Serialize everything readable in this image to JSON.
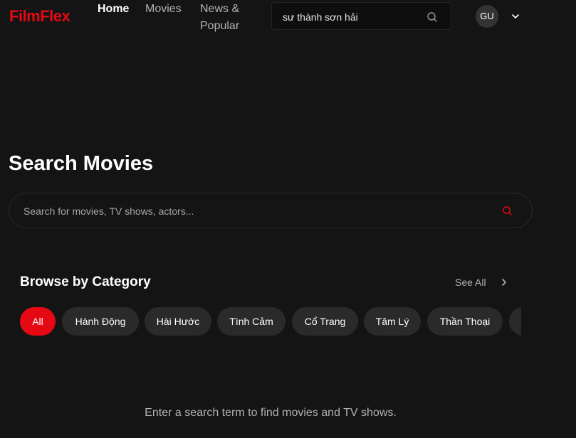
{
  "brand": {
    "logo_text": "FilmFlex",
    "accent_color": "#e50914"
  },
  "nav": {
    "items": [
      {
        "label": "Home",
        "active": true
      },
      {
        "label": "Movies",
        "active": false
      },
      {
        "label": "News & Popular",
        "active": false
      }
    ]
  },
  "header_search": {
    "value": "sư thành sơn hải",
    "icon": "search-icon"
  },
  "user": {
    "initials": "GU",
    "menu_icon": "chevron-down-icon"
  },
  "page": {
    "title": "Search Movies"
  },
  "main_search": {
    "value": "",
    "placeholder": "Search for movies, TV shows, actors...",
    "icon": "search-icon"
  },
  "categories": {
    "title": "Browse by Category",
    "see_all_label": "See All",
    "see_all_icon": "chevron-right-icon",
    "items": [
      {
        "label": "All",
        "active": true
      },
      {
        "label": "Hành Động",
        "active": false
      },
      {
        "label": "Hài Hước",
        "active": false
      },
      {
        "label": "Tình Cảm",
        "active": false
      },
      {
        "label": "Cổ Trang",
        "active": false
      },
      {
        "label": "Tâm Lý",
        "active": false
      },
      {
        "label": "Thần Thoại",
        "active": false
      },
      {
        "label": "",
        "active": false
      }
    ]
  },
  "empty_state": {
    "message": "Enter a search term to find movies and TV shows."
  }
}
